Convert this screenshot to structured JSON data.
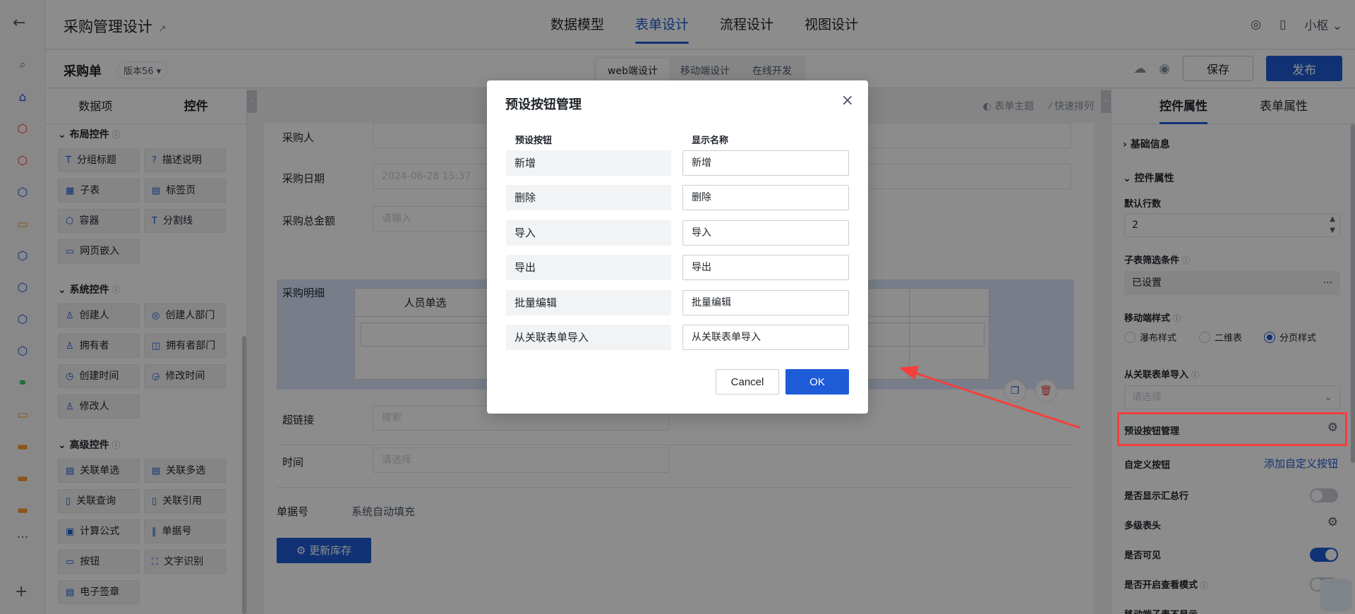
{
  "app": {
    "title": "采购管理设计"
  },
  "top_tabs": [
    "数据模型",
    "表单设计",
    "流程设计",
    "视图设计"
  ],
  "user": {
    "name": "小枢"
  },
  "subbar": {
    "form_name": "采购单",
    "version": "版本56",
    "modes": [
      "web端设计",
      "移动端设计",
      "在线开发"
    ],
    "save": "保存",
    "publish": "发布"
  },
  "left_panel": {
    "tabs": [
      "数据项",
      "控件"
    ],
    "section_layout": "布局控件",
    "layout_items": [
      "分组标题",
      "描述说明",
      "子表",
      "标签页",
      "容器",
      "分割线",
      "网页嵌入"
    ],
    "section_system": "系统控件",
    "system_items": [
      "创建人",
      "创建人部门",
      "拥有者",
      "拥有者部门",
      "创建时间",
      "修改时间",
      "修改人"
    ],
    "section_advanced": "高级控件",
    "advanced_items": [
      "关联单选",
      "关联多选",
      "关联查询",
      "关联引用",
      "计算公式",
      "单据号",
      "按钮",
      "文字识别",
      "电子签章"
    ]
  },
  "canvas": {
    "tools": [
      "表单主题",
      "快速排列"
    ],
    "fields": {
      "buyer": "采购人",
      "date": "采购日期",
      "date_value": "2024-06-28 15:37",
      "amount": "采购总金额",
      "amount_placeholder": "请输入",
      "detail": "采购明细",
      "detail_col": "人员单选",
      "link": "超链接",
      "link_placeholder": "搜索",
      "time": "时间",
      "time_placeholder": "请选择",
      "doc_no": "单据号",
      "doc_no_value": "系统自动填充",
      "update_btn": "更新库存"
    }
  },
  "right_panel": {
    "tabs": [
      "控件属性",
      "表单属性"
    ],
    "basic_info": "基础信息",
    "control_props": "控件属性",
    "default_rows_label": "默认行数",
    "default_rows_value": "2",
    "filter_label": "子表筛选条件",
    "filter_value": "已设置",
    "mobile_style_label": "移动端样式",
    "mobile_styles": [
      "瀑布样式",
      "二维表",
      "分页样式"
    ],
    "import_label": "从关联表单导入",
    "import_placeholder": "请选择",
    "preset_mgmt": "预设按钮管理",
    "custom_btn": "自定义按钮",
    "add_custom": "添加自定义按钮",
    "show_total": "是否显示汇总行",
    "multi_header": "多级表头",
    "visible": "是否可见",
    "view_mode": "是否开启查看模式",
    "mobile_hide": "移动端子表不显示"
  },
  "modal": {
    "title": "预设按钮管理",
    "col_preset": "预设按钮",
    "col_display": "显示名称",
    "rows": [
      {
        "name": "新增",
        "display": "新增"
      },
      {
        "name": "删除",
        "display": "删除"
      },
      {
        "name": "导入",
        "display": "导入"
      },
      {
        "name": "导出",
        "display": "导出"
      },
      {
        "name": "批量编辑",
        "display": "批量编辑"
      },
      {
        "name": "从关联表单导入",
        "display": "从关联表单导入"
      }
    ],
    "cancel": "Cancel",
    "ok": "OK"
  },
  "colors": {
    "primary": "#1e5bd6",
    "highlight": "#f53f3f"
  }
}
